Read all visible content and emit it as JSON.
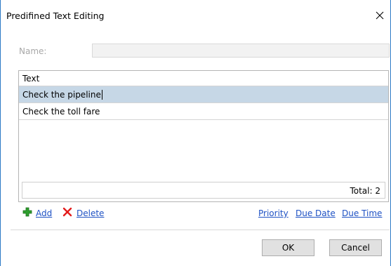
{
  "window": {
    "title": "Predifined Text Editing",
    "close_glyph": "✕"
  },
  "name_field": {
    "label": "Name:",
    "value": ""
  },
  "grid": {
    "header": "Text",
    "rows": [
      {
        "text": "Check the pipeline",
        "selected": true
      },
      {
        "text": "Check the toll fare",
        "selected": false
      }
    ],
    "total_label": "Total: 2"
  },
  "toolbar": {
    "add_label": "Add",
    "delete_label": "Delete",
    "priority_label": "Priority",
    "due_date_label": "Due Date",
    "due_time_label": "Due Time",
    "add_icon": "plus-icon",
    "delete_icon": "red-x-icon",
    "add_icon_color": "#2e9e2e",
    "delete_icon_color": "#e31b1b"
  },
  "buttons": {
    "ok_label": "OK",
    "cancel_label": "Cancel"
  },
  "colors": {
    "selection": "#c6d7e6",
    "link": "#1f52c4",
    "window_border": "#2b79c6"
  }
}
